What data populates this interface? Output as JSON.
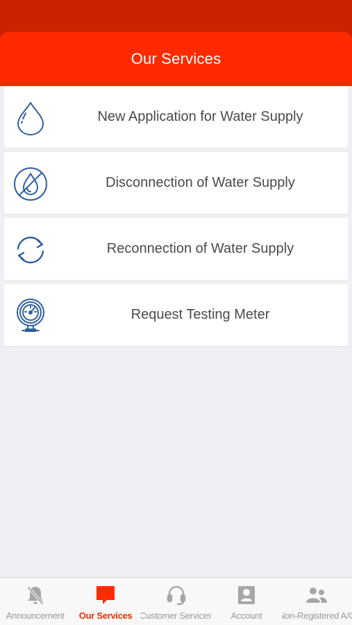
{
  "header": {
    "title": "Our Services"
  },
  "services": [
    {
      "label": "New Application for Water Supply",
      "icon": "water-drop-icon"
    },
    {
      "label": "Disconnection of Water Supply",
      "icon": "no-water-icon"
    },
    {
      "label": "Reconnection of Water Supply",
      "icon": "refresh-icon"
    },
    {
      "label": "Request Testing Meter",
      "icon": "water-meter-icon"
    }
  ],
  "tabs": [
    {
      "label": "Announcement",
      "icon": "mute-bell-icon",
      "active": false
    },
    {
      "label": "Our Services",
      "icon": "chat-bubble-icon",
      "active": true
    },
    {
      "label": "Customer Services",
      "icon": "headset-icon",
      "active": false
    },
    {
      "label": "Account",
      "icon": "account-icon",
      "active": false
    },
    {
      "label": "Non-Registered A/C",
      "icon": "people-icon",
      "active": false
    }
  ],
  "colors": {
    "header": "#ff2a00",
    "status_bar": "#cc2200",
    "icon_blue": "#2f5f9e",
    "active_tab": "#e63000",
    "inactive_tab": "#9a9a9a"
  }
}
